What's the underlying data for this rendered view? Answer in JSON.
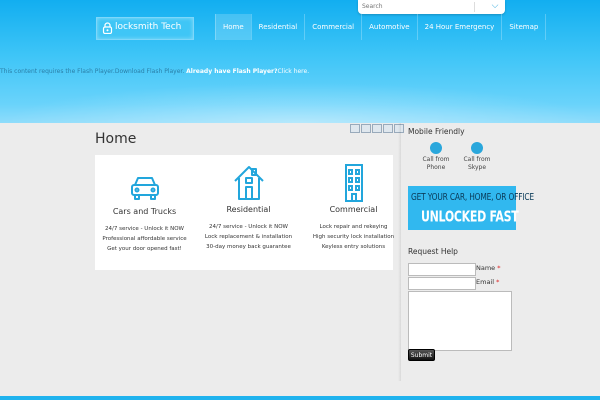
{
  "search": {
    "placeholder": "Search"
  },
  "logo": {
    "text": "locksmith Tech"
  },
  "nav": [
    {
      "label": "Home",
      "active": true
    },
    {
      "label": "Residential"
    },
    {
      "label": "Commercial"
    },
    {
      "label": "Automotive"
    },
    {
      "label": "24 Hour Emergency"
    },
    {
      "label": "Sitemap"
    }
  ],
  "flash": {
    "message": "This content requires the Flash Player.",
    "download": "Download Flash Player",
    "already": "Already have Flash Player?",
    "click": "Click here."
  },
  "page": {
    "title": "Home"
  },
  "share_icons": [
    "email-icon",
    "print-icon",
    "bookmark-icon",
    "facebook-icon",
    "twitter-icon"
  ],
  "services": [
    {
      "icon": "car-icon",
      "title": "Cars and Trucks",
      "lines": [
        "24/7 service - Unlock it NOW",
        "Professional affordable service",
        "Get your door opened fast!"
      ]
    },
    {
      "icon": "house-icon",
      "title": "Residential",
      "lines": [
        "24/7 service - Unlock it NOW",
        "Lock replacement & installation",
        "30-day money back guarantee"
      ]
    },
    {
      "icon": "building-icon",
      "title": "Commercial",
      "lines": [
        "Lock repair and rekeying",
        "High security lock installation",
        "Keyless entry solutions"
      ]
    }
  ],
  "sidebar": {
    "mobile_title": "Mobile Friendly",
    "call_phone": [
      "Call from",
      "Phone"
    ],
    "call_skype": [
      "Call from",
      "Skype"
    ],
    "banner_line1": "GET YOUR CAR, HOME, OR OFFICE",
    "banner_line2": "UNLOCKED FAST",
    "request_title": "Request Help",
    "name_label": "Name",
    "email_label": "Email",
    "required_mark": "*",
    "submit_label": "Submit"
  },
  "colors": {
    "header": "#12aef0",
    "accent": "#2aa7dc",
    "icon_stroke": "#22a6dc"
  }
}
